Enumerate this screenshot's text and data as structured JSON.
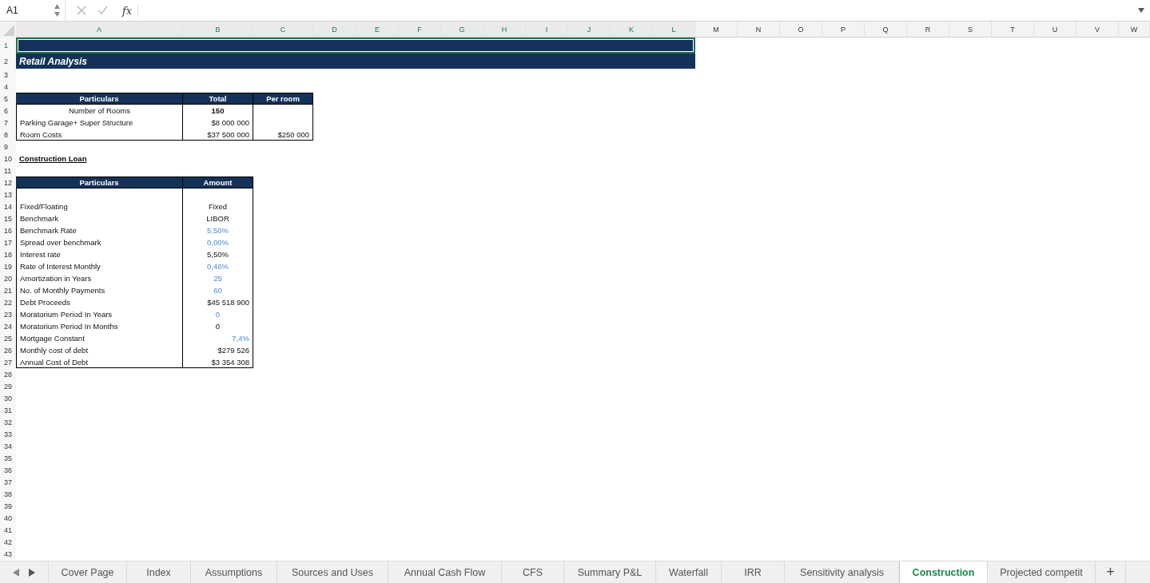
{
  "formula_bar": {
    "cell_ref": "A1",
    "fx": "fx"
  },
  "columns": [
    {
      "label": "A",
      "selected": true
    },
    {
      "label": "B",
      "selected": true
    },
    {
      "label": "C",
      "selected": true
    },
    {
      "label": "D",
      "selected": true
    },
    {
      "label": "E",
      "selected": true
    },
    {
      "label": "F",
      "selected": true
    },
    {
      "label": "G",
      "selected": true
    },
    {
      "label": "H",
      "selected": true
    },
    {
      "label": "I",
      "selected": true
    },
    {
      "label": "J",
      "selected": true
    },
    {
      "label": "K",
      "selected": true
    },
    {
      "label": "L",
      "selected": true
    },
    {
      "label": "M",
      "selected": false
    },
    {
      "label": "N",
      "selected": false
    },
    {
      "label": "O",
      "selected": false
    },
    {
      "label": "P",
      "selected": false
    },
    {
      "label": "Q",
      "selected": false
    },
    {
      "label": "R",
      "selected": false
    },
    {
      "label": "S",
      "selected": false
    },
    {
      "label": "T",
      "selected": false
    },
    {
      "label": "U",
      "selected": false
    },
    {
      "label": "V",
      "selected": false
    },
    {
      "label": "W",
      "selected": false
    }
  ],
  "row_numbers": [
    {
      "label": "1",
      "selected": true
    },
    {
      "label": "2",
      "selected": false
    },
    {
      "label": "3",
      "selected": false
    },
    {
      "label": "4",
      "selected": false
    },
    {
      "label": "5",
      "selected": false
    },
    {
      "label": "6",
      "selected": false
    },
    {
      "label": "7",
      "selected": false
    },
    {
      "label": "8",
      "selected": false
    },
    {
      "label": "9",
      "selected": false
    },
    {
      "label": "10",
      "selected": false
    },
    {
      "label": "11",
      "selected": false
    },
    {
      "label": "12",
      "selected": false
    },
    {
      "label": "13",
      "selected": false
    },
    {
      "label": "14",
      "selected": false
    },
    {
      "label": "15",
      "selected": false
    },
    {
      "label": "16",
      "selected": false
    },
    {
      "label": "17",
      "selected": false
    },
    {
      "label": "18",
      "selected": false
    },
    {
      "label": "19",
      "selected": false
    },
    {
      "label": "20",
      "selected": false
    },
    {
      "label": "21",
      "selected": false
    },
    {
      "label": "22",
      "selected": false
    },
    {
      "label": "23",
      "selected": false
    },
    {
      "label": "24",
      "selected": false
    },
    {
      "label": "25",
      "selected": false
    },
    {
      "label": "26",
      "selected": false
    },
    {
      "label": "27",
      "selected": false
    },
    {
      "label": "28",
      "selected": false
    },
    {
      "label": "29",
      "selected": false
    },
    {
      "label": "30",
      "selected": false
    },
    {
      "label": "31",
      "selected": false
    },
    {
      "label": "32",
      "selected": false
    },
    {
      "label": "33",
      "selected": false
    },
    {
      "label": "34",
      "selected": false
    },
    {
      "label": "35",
      "selected": false
    },
    {
      "label": "36",
      "selected": false
    },
    {
      "label": "37",
      "selected": false
    },
    {
      "label": "38",
      "selected": false
    },
    {
      "label": "39",
      "selected": false
    },
    {
      "label": "40",
      "selected": false
    },
    {
      "label": "41",
      "selected": false
    },
    {
      "label": "42",
      "selected": false
    },
    {
      "label": "43",
      "selected": false
    }
  ],
  "title": "Retail Analysis",
  "rooms_table": {
    "columns": [
      "Particulars",
      "Total",
      "Per room"
    ],
    "rows": [
      {
        "kind": "count",
        "particulars": "Number of Rooms",
        "total": "150"
      },
      {
        "kind": "amount",
        "particulars": "Parking Garage+ Super Structure",
        "total": "$8 000 000"
      },
      {
        "kind": "amount",
        "particulars": "Room Costs",
        "total": "$37 500 000",
        "per_room": "$250 000"
      }
    ]
  },
  "construction_loan": {
    "heading": "Construction Loan",
    "columns": [
      "Particulars",
      "Amount"
    ],
    "rows": [
      {
        "label": "Fixed/Floating",
        "value": "Fixed",
        "kind": "text",
        "input": false
      },
      {
        "label": "Benchmark",
        "value": "LIBOR",
        "kind": "text",
        "input": false
      },
      {
        "label": "Benchmark Rate",
        "value": "5,50%",
        "kind": "rate",
        "input": true
      },
      {
        "label": "Spread over benchmark",
        "value": "0,00%",
        "kind": "rate",
        "input": true
      },
      {
        "label": "Interest rate",
        "value": "5,50%",
        "kind": "rate",
        "input": false
      },
      {
        "label": "Rate of Interest Monthly",
        "value": "0,46%",
        "kind": "rate",
        "input": true
      },
      {
        "label": "Amortization in Years",
        "value": "25",
        "kind": "count",
        "input": true
      },
      {
        "label": "No. of Monthly Payments",
        "value": "60",
        "kind": "count",
        "input": true
      },
      {
        "label": "Debt Proceeds",
        "value": "$45 518 900",
        "kind": "currency",
        "input": false
      },
      {
        "label": "Moratorium Period In Years",
        "value": "0",
        "kind": "count",
        "input": true
      },
      {
        "label": "Moratorium Period In Months",
        "value": "0",
        "kind": "count",
        "input": false
      },
      {
        "label": "Mortgage Constant",
        "value": "7,4%",
        "kind": "constant",
        "input": true
      },
      {
        "label": "Monthly cost of debt",
        "value": "$279 526",
        "kind": "currency",
        "input": false
      },
      {
        "label": "Annual Cost of Debt",
        "value": "$3 354 308",
        "kind": "currency",
        "input": false
      }
    ]
  },
  "sheet_tabs": [
    {
      "label": "Cover Page",
      "selected": false
    },
    {
      "label": "Index",
      "selected": false
    },
    {
      "label": "Assumptions",
      "selected": false
    },
    {
      "label": "Sources and Uses",
      "selected": false
    },
    {
      "label": "Annual Cash Flow",
      "selected": false
    },
    {
      "label": "CFS",
      "selected": false
    },
    {
      "label": "Summary P&L",
      "selected": false
    },
    {
      "label": "Waterfall",
      "selected": false
    },
    {
      "label": "IRR",
      "selected": false
    },
    {
      "label": "Sensitivity analysis",
      "selected": false
    },
    {
      "label": "Construction",
      "selected": true
    },
    {
      "label": "Projected competit",
      "selected": false
    }
  ],
  "add_sheet": "+"
}
